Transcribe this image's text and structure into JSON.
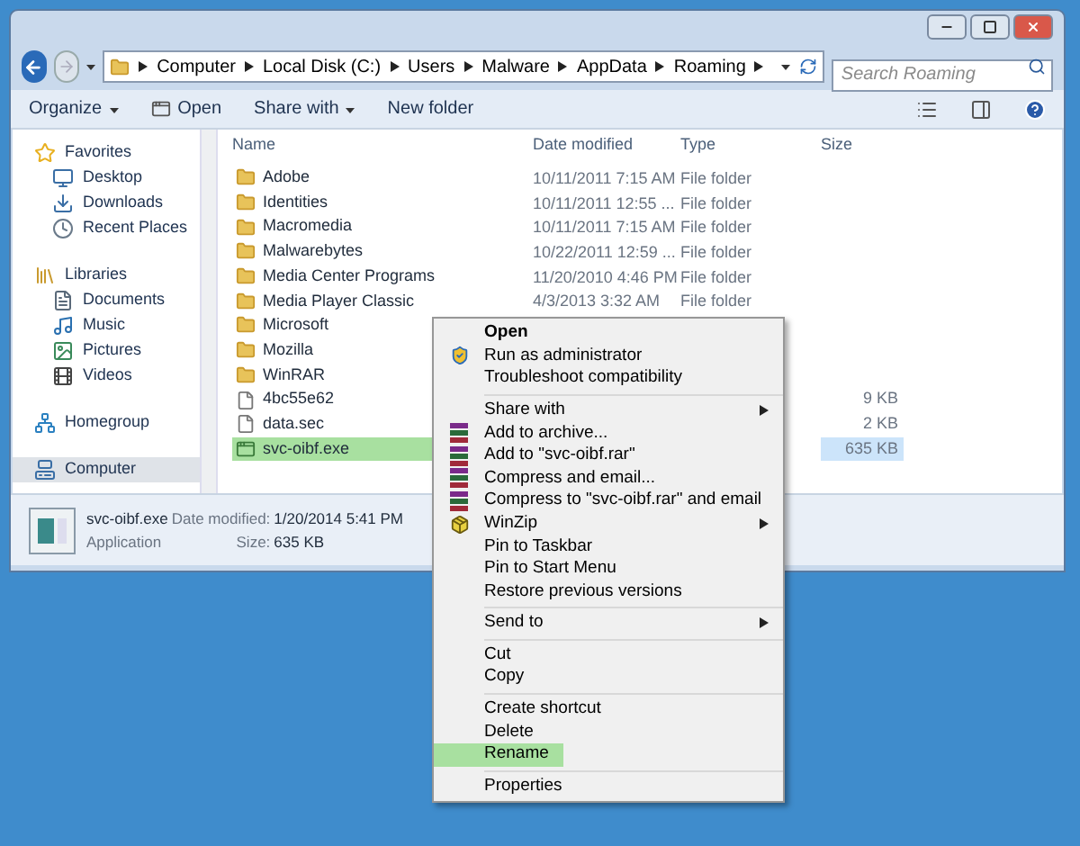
{
  "window": {
    "controls": [
      {
        "kind": "minimize"
      },
      {
        "kind": "maximize"
      },
      {
        "kind": "close"
      }
    ]
  },
  "address": {
    "crumbs": [
      "Computer",
      "Local Disk (C:)",
      "Users",
      "Malware",
      "AppData",
      "Roaming"
    ]
  },
  "search": {
    "placeholder": "Search Roaming"
  },
  "toolbar": {
    "buttons": [
      {
        "label": "Organize",
        "kind": "dropdown"
      },
      {
        "label": "Open",
        "kind": "open"
      },
      {
        "label": "Share with",
        "kind": "dropdown"
      },
      {
        "label": "New folder",
        "kind": "plain"
      }
    ]
  },
  "sidebar": {
    "groups": [
      {
        "label": "Favorites",
        "kind": "favorites",
        "selected": false,
        "children": [
          {
            "label": "Desktop",
            "kind": "desktop",
            "selected": false
          },
          {
            "label": "Downloads",
            "kind": "downloads",
            "selected": false
          },
          {
            "label": "Recent Places",
            "kind": "recent",
            "selected": false
          }
        ]
      },
      {
        "label": "Libraries",
        "kind": "libraries",
        "selected": false,
        "children": [
          {
            "label": "Documents",
            "kind": "documents",
            "selected": false
          },
          {
            "label": "Music",
            "kind": "music",
            "selected": false
          },
          {
            "label": "Pictures",
            "kind": "pictures",
            "selected": false
          },
          {
            "label": "Videos",
            "kind": "videos",
            "selected": false
          }
        ]
      },
      {
        "label": "Homegroup",
        "kind": "homegroup",
        "selected": false
      },
      {
        "label": "Computer",
        "kind": "computer",
        "selected": true
      }
    ]
  },
  "table": {
    "columns": [
      "Name",
      "Date modified",
      "Type",
      "Size"
    ],
    "rows": [
      {
        "kind": "folder",
        "name": "Adobe",
        "date": "10/11/2011 7:15 AM",
        "type": "File folder",
        "selected": false
      },
      {
        "kind": "folder",
        "name": "Identities",
        "date": "10/11/2011 12:55 ...",
        "type": "File folder",
        "selected": false
      },
      {
        "kind": "folder",
        "name": "Macromedia",
        "date": "10/11/2011 7:15 AM",
        "type": "File folder",
        "selected": false
      },
      {
        "kind": "folder",
        "name": "Malwarebytes",
        "date": "10/22/2011 12:59 ...",
        "type": "File folder",
        "selected": false
      },
      {
        "kind": "folder",
        "name": "Media Center Programs",
        "date": "11/20/2010 4:46 PM",
        "type": "File folder",
        "selected": false
      },
      {
        "kind": "folder",
        "name": "Media Player Classic",
        "date": "4/3/2013 3:32 AM",
        "type": "File folder",
        "selected": false
      },
      {
        "kind": "folder",
        "name": "Microsoft",
        "selected": false
      },
      {
        "kind": "folder",
        "name": "Mozilla",
        "selected": false
      },
      {
        "kind": "folder",
        "name": "WinRAR",
        "selected": false
      },
      {
        "kind": "file",
        "name": "4bc55e62",
        "size": "9 KB",
        "selected": false
      },
      {
        "kind": "file",
        "name": "data.sec",
        "size": "2 KB",
        "selected": false
      },
      {
        "kind": "app",
        "name": "svc-oibf.exe",
        "size": "635 KB",
        "selected": true
      }
    ]
  },
  "details": {
    "name": "svc-oibf.exe",
    "type": "Application",
    "date_label": "Date modified:",
    "date": "1/20/2014 5:41 PM",
    "size_label": "Size:",
    "size": "635 KB"
  },
  "context_menu": {
    "groups": [
      [
        {
          "label": "Open",
          "kind": "plain",
          "bold": true,
          "submenu": false,
          "highlighted": false
        },
        {
          "label": "Run as administrator",
          "kind": "admin",
          "bold": false,
          "submenu": false,
          "highlighted": false
        },
        {
          "label": "Troubleshoot compatibility",
          "kind": "plain",
          "bold": false,
          "submenu": false,
          "highlighted": false
        }
      ],
      [
        {
          "label": "Share with",
          "kind": "plain",
          "bold": false,
          "submenu": true,
          "highlighted": false
        },
        {
          "label": "Add to archive...",
          "kind": "archiver",
          "bold": false,
          "submenu": false,
          "highlighted": false
        },
        {
          "label": "Add to \"svc-oibf.rar\"",
          "kind": "archiver",
          "bold": false,
          "submenu": false,
          "highlighted": false
        },
        {
          "label": "Compress and email...",
          "kind": "archiver",
          "bold": false,
          "submenu": false,
          "highlighted": false
        },
        {
          "label": "Compress to \"svc-oibf.rar\" and email",
          "kind": "archiver",
          "bold": false,
          "submenu": false,
          "highlighted": false
        },
        {
          "label": "WinZip",
          "kind": "zipper",
          "bold": false,
          "submenu": true,
          "highlighted": false
        },
        {
          "label": "Pin to Taskbar",
          "kind": "plain",
          "bold": false,
          "submenu": false,
          "highlighted": false
        },
        {
          "label": "Pin to Start Menu",
          "kind": "plain",
          "bold": false,
          "submenu": false,
          "highlighted": false
        },
        {
          "label": "Restore previous versions",
          "kind": "plain",
          "bold": false,
          "submenu": false,
          "highlighted": false
        }
      ],
      [
        {
          "label": "Send to",
          "kind": "plain",
          "bold": false,
          "submenu": true,
          "highlighted": false
        }
      ],
      [
        {
          "label": "Cut",
          "kind": "plain",
          "bold": false,
          "submenu": false,
          "highlighted": false
        },
        {
          "label": "Copy",
          "kind": "plain",
          "bold": false,
          "submenu": false,
          "highlighted": false
        }
      ],
      [
        {
          "label": "Create shortcut",
          "kind": "plain",
          "bold": false,
          "submenu": false,
          "highlighted": false
        },
        {
          "label": "Delete",
          "kind": "plain",
          "bold": false,
          "submenu": false,
          "highlighted": false
        },
        {
          "label": "Rename",
          "kind": "plain",
          "bold": false,
          "submenu": false,
          "highlighted": true
        }
      ],
      [
        {
          "label": "Properties",
          "kind": "plain",
          "bold": false,
          "submenu": false,
          "highlighted": false
        }
      ]
    ]
  }
}
